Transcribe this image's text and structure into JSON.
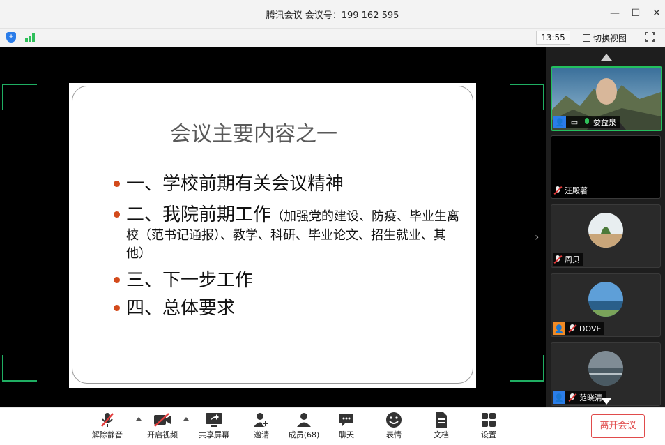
{
  "window": {
    "title": "腾讯会议 会议号：199 162 595",
    "minimize": "—",
    "maximize": "☐",
    "close": "✕"
  },
  "infobar": {
    "time": "13:55",
    "switch_view": "切换视图",
    "icons": [
      "shield-icon",
      "signal-icon",
      "grid-view-icon",
      "fullscreen-icon"
    ]
  },
  "slide": {
    "title": "会议主要内容之一",
    "bullets": [
      {
        "main": "一、学校前期有关会议精神"
      },
      {
        "main": "二、我院前期工作",
        "detail": "（加强党的建设、防疫、毕业生离校（范书记通报）、教学、科研、毕业论文、招生就业、其他）"
      },
      {
        "main": "三、下一步工作"
      },
      {
        "main": "四、总体要求"
      }
    ],
    "bullet_color": "#d34a1b"
  },
  "participants": [
    {
      "name": "娄益泉",
      "muted": false,
      "host": true,
      "video": true
    },
    {
      "name": "汪殿著",
      "muted": true,
      "video": false
    },
    {
      "name": "周贝",
      "muted": true,
      "avatar": true
    },
    {
      "name": "DOVE",
      "muted": true,
      "avatar": true,
      "badge": true
    },
    {
      "name": "范晓清",
      "muted": true,
      "avatar": true,
      "host": true
    }
  ],
  "toolbar": {
    "unmute": "解除静音",
    "start_video": "开启视频",
    "share_screen": "共享屏幕",
    "invite": "邀请",
    "members": "成员(68)",
    "chat": "聊天",
    "reactions": "表情",
    "docs": "文档",
    "settings": "设置",
    "leave": "离开会议"
  },
  "colors": {
    "accent_green": "#23c05e",
    "danger_red": "#e04b4b",
    "brand_blue": "#2b7de9"
  }
}
